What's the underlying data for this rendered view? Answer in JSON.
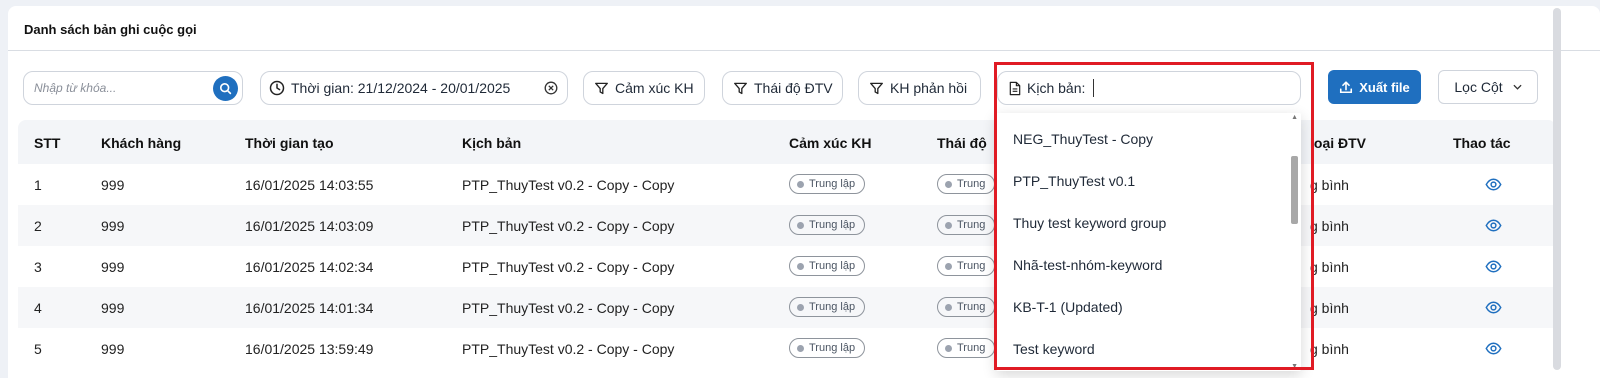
{
  "card": {
    "title": "Danh sách bản ghi cuộc gọi"
  },
  "filters": {
    "search_placeholder": "Nhập từ khóa...",
    "time_label": "Thời gian: 21/12/2024 - 20/01/2025",
    "emotion_label": "Cảm xúc KH",
    "attitude_label": "Thái độ ĐTV",
    "feedback_label": "KH phản hồi",
    "script_label": "Kịch bản:",
    "export_label": "Xuất file",
    "columns_label": "Lọc Cột"
  },
  "table": {
    "headers": {
      "stt": "STT",
      "customer": "Khách hàng",
      "created": "Thời gian tạo",
      "script": "Kịch bản",
      "emotion": "Cảm xúc KH",
      "attitude": "Thái độ",
      "rating": "loại ĐTV",
      "actions": "Thao tác"
    },
    "rows": [
      {
        "stt": "1",
        "customer": "999",
        "created": "16/01/2025 14:03:55",
        "script": "PTP_ThuyTest v0.2 - Copy - Copy",
        "emotion": "Trung lập",
        "attitude": "Trung",
        "rating": "g bình"
      },
      {
        "stt": "2",
        "customer": "999",
        "created": "16/01/2025 14:03:09",
        "script": "PTP_ThuyTest v0.2 - Copy - Copy",
        "emotion": "Trung lập",
        "attitude": "Trung",
        "rating": "g bình"
      },
      {
        "stt": "3",
        "customer": "999",
        "created": "16/01/2025 14:02:34",
        "script": "PTP_ThuyTest v0.2 - Copy - Copy",
        "emotion": "Trung lập",
        "attitude": "Trung",
        "rating": "g bình"
      },
      {
        "stt": "4",
        "customer": "999",
        "created": "16/01/2025 14:01:34",
        "script": "PTP_ThuyTest v0.2 - Copy - Copy",
        "emotion": "Trung lập",
        "attitude": "Trung",
        "rating": "g bình"
      },
      {
        "stt": "5",
        "customer": "999",
        "created": "16/01/2025 13:59:49",
        "script": "PTP_ThuyTest v0.2 - Copy - Copy",
        "emotion": "Trung lập",
        "attitude": "Trung",
        "rating": "g bình"
      }
    ]
  },
  "dropdown": {
    "options": [
      "NEG_ThuyTest - Copy",
      "PTP_ThuyTest v0.1",
      "Thuy test keyword group",
      "Nhã-test-nhóm-keyword",
      "KB-T-1 (Updated)",
      "Test keyword"
    ]
  },
  "icons": {
    "search": "search-icon",
    "clock": "clock-icon",
    "clear": "clear-icon",
    "filter": "filter-funnel-icon",
    "document": "document-icon",
    "upload": "upload-icon",
    "chevron": "chevron-down-icon",
    "eye": "eye-icon"
  },
  "colors": {
    "primary": "#1f6fbf",
    "highlight": "#e01b24",
    "badge_border": "#8e949c",
    "header_bg": "#f3f5f8"
  }
}
